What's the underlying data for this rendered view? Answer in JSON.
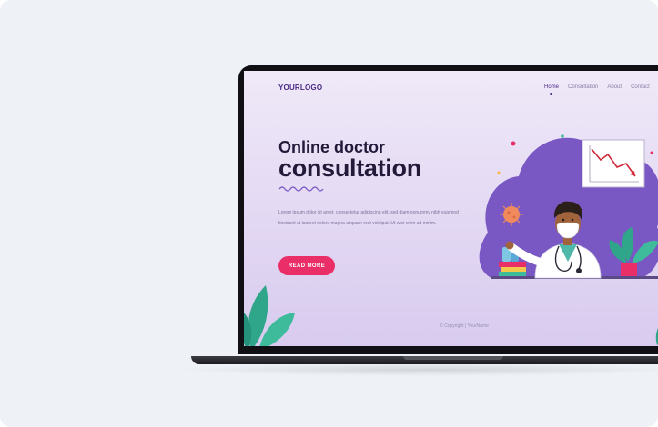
{
  "site": {
    "logo": "YOURLOGO",
    "nav": [
      "Home",
      "Consultation",
      "About",
      "Contact"
    ],
    "hero": {
      "subtitle": "Online doctor",
      "title": "consultation",
      "body": "Lorem ipsum dolor sit amet, consectetur adipiscing elit, sed diam nonummy nibh euismod tincidunt ut laoreet dolore magna aliquam erat volutpat. Ut wisi enim ad minim.",
      "cta": "READ MORE"
    },
    "footer": "© Copyright  |  YourName"
  },
  "colors": {
    "accent": "#ea2f68",
    "brand": "#4b2a86",
    "heading": "#231a3a",
    "blob": "#7a58c4"
  },
  "icons": {
    "illustration": "doctor-illustration",
    "chart": "decline-chart-icon",
    "virus": "virus-icon",
    "plant": "plant-icon"
  }
}
